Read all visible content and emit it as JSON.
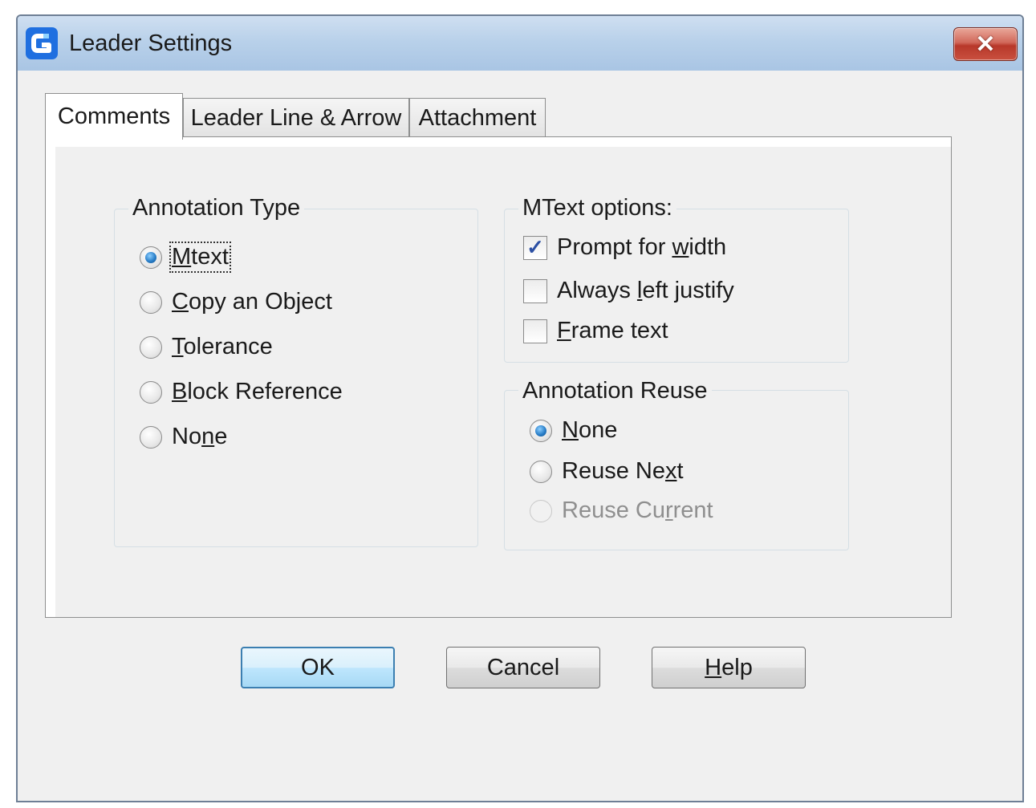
{
  "window": {
    "title": "Leader Settings",
    "close_glyph": "✕",
    "icon": "app-logo-icon"
  },
  "tabs": [
    {
      "label": "Comments",
      "active": true
    },
    {
      "label": "Leader Line & Arrow",
      "active": false
    },
    {
      "label": "Attachment",
      "active": false
    }
  ],
  "annotation_type": {
    "title": "Annotation Type",
    "selected": "Mtext",
    "options": [
      {
        "pre": "",
        "key": "M",
        "post": "text"
      },
      {
        "pre": "",
        "key": "C",
        "post": "opy an Object"
      },
      {
        "pre": "",
        "key": "T",
        "post": "olerance"
      },
      {
        "pre": "",
        "key": "B",
        "post": "lock Reference"
      },
      {
        "pre": "No",
        "key": "n",
        "post": "e"
      }
    ]
  },
  "mtext_options": {
    "title": "MText options:",
    "items": [
      {
        "pre": "Prompt for ",
        "key": "w",
        "post": "idth",
        "checked": true
      },
      {
        "pre": "Always ",
        "key": "l",
        "post": "eft justify",
        "checked": false
      },
      {
        "pre": "",
        "key": "F",
        "post": "rame text",
        "checked": false
      }
    ],
    "check_glyph": "✓"
  },
  "annotation_reuse": {
    "title": "Annotation Reuse",
    "selected": "None",
    "options": [
      {
        "pre": "",
        "key": "N",
        "post": "one",
        "enabled": true
      },
      {
        "pre": "Reuse Ne",
        "key": "x",
        "post": "t",
        "enabled": true
      },
      {
        "pre": "Reuse Cu",
        "key": "r",
        "post": "rent",
        "enabled": false
      }
    ]
  },
  "buttons": {
    "ok": {
      "pre": "OK",
      "key": "",
      "post": ""
    },
    "cancel": {
      "pre": "Cancel",
      "key": "",
      "post": ""
    },
    "help": {
      "pre": "",
      "key": "H",
      "post": "elp"
    }
  },
  "colors": {
    "accent": "#2a7fc9",
    "titlebar": "#b9d1ea",
    "close": "#c9503f"
  }
}
